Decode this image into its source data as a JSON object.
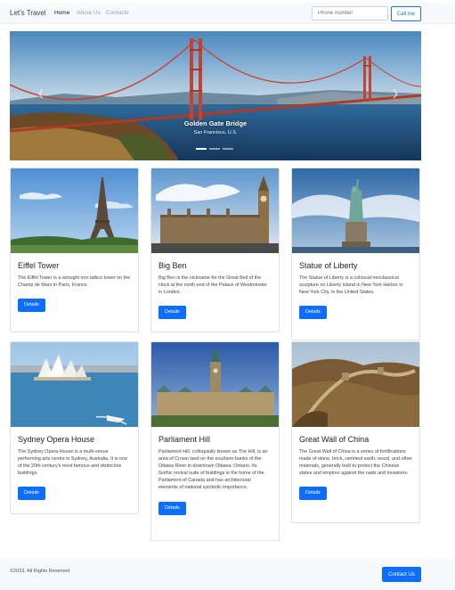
{
  "nav": {
    "brand": "Let's Travel",
    "links": [
      "Home",
      "About Us",
      "Contacts"
    ],
    "phone_placeholder": "Phone number",
    "call_label": "Call me"
  },
  "carousel": {
    "title": "Golden Gate Bridge",
    "subtitle": "San Francisco, U.S.",
    "slide_count": 3,
    "active_slide": 1
  },
  "cards": [
    {
      "title": "Eiffel Tower",
      "text": "The Eiffel Tower is a wrought iron lattice tower on the Champ de Mars in Paris, France.",
      "button": "Details",
      "image": "eiffel-tower-photo"
    },
    {
      "title": "Big Ben",
      "text": "Big Ben is the nickname for the Great Bell of the clock at the north end of the Palace of Westminster in London.",
      "button": "Details",
      "image": "big-ben-photo"
    },
    {
      "title": "Statue of Liberty",
      "text": "The Statue of Liberty is a colossal neoclassical sculpture on Liberty Island in New York Harbor in New York City, in the United States.",
      "button": "Details",
      "image": "statue-of-liberty-photo"
    },
    {
      "title": "Sydney Opera House",
      "text": "The Sydney Opera House is a multi-venue performing arts centre in Sydney, Australia. It is one of the 20th century's most famous and distinctive buildings.",
      "button": "Details",
      "image": "sydney-opera-house-photo"
    },
    {
      "title": "Parliament Hill",
      "text": "Parliament Hill, colloquially known as The Hill, is an area of Crown land on the southern banks of the Ottawa River in downtown Ottawa, Ontario. Its Gothic revival suite of buildings is the home of the Parliament of Canada and has architectural elements of national symbolic importance.",
      "button": "Details",
      "image": "parliament-hill-photo"
    },
    {
      "title": "Great Wall of China",
      "text": "The Great Wall of China is a series of fortifications made of stone, brick, rammed earth, wood, and other materials, generally built to protect the Chinese states and empires against the raids and invasions.",
      "button": "Details",
      "image": "great-wall-photo"
    }
  ],
  "footer": {
    "copyright": "©2033, All Rights Reserved",
    "contact_label": "Contact Us"
  },
  "colors": {
    "primary": "#0d6efd",
    "navbar_bg": "#f8f9fa",
    "bridge_red": "#c9412a"
  }
}
